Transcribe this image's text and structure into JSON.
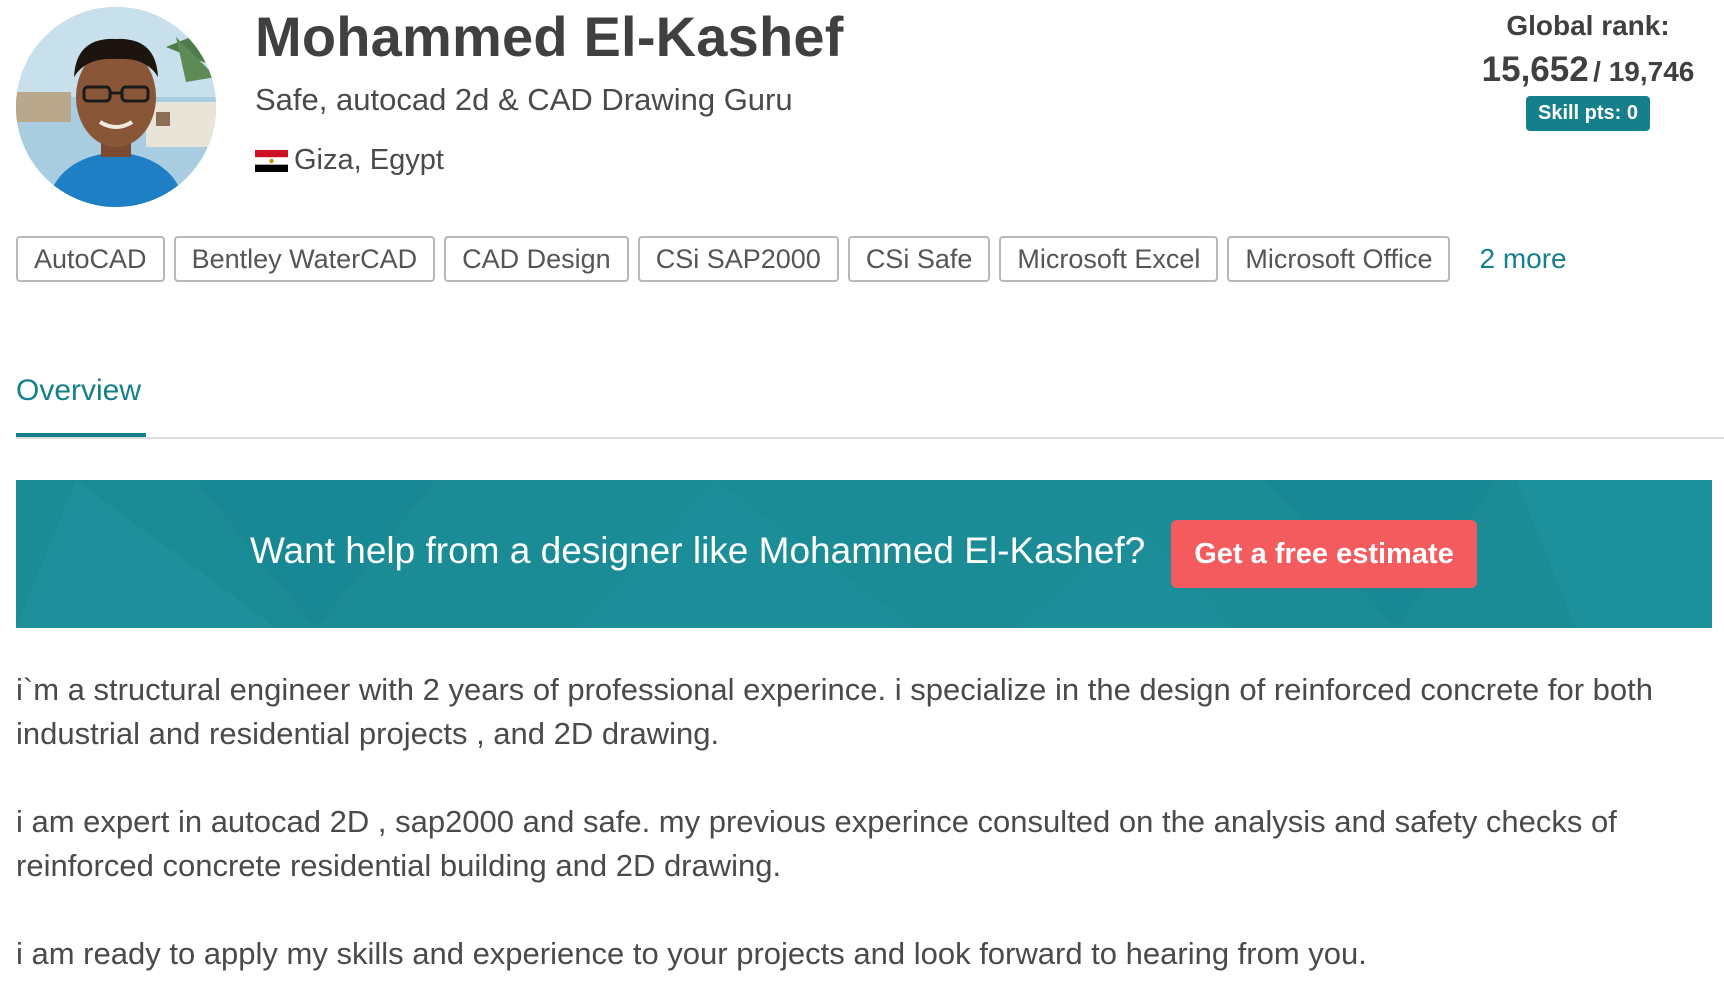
{
  "profile": {
    "name": "Mohammed El-Kashef",
    "tagline": "Safe, autocad 2d & CAD Drawing Guru",
    "location": "Giza, Egypt"
  },
  "rank": {
    "label": "Global rank:",
    "value": "15,652",
    "total": "/ 19,746",
    "skill_pts": "Skill pts: 0"
  },
  "skills": {
    "tags": [
      "AutoCAD",
      "Bentley WaterCAD",
      "CAD Design",
      "CSi SAP2000",
      "CSi Safe",
      "Microsoft Excel",
      "Microsoft Office"
    ],
    "more_label": "2 more"
  },
  "tabs": {
    "overview_label": "Overview"
  },
  "banner": {
    "text": "Want help from a designer like Mohammed El-Kashef?",
    "button_label": "Get a free estimate"
  },
  "bio": {
    "paragraphs": [
      "i`m a structural engineer with 2 years of professional experince. i specialize in the design of reinforced concrete for both industrial and residential projects , and 2D drawing.",
      "i am expert in autocad 2D , sap2000 and safe. my previous experince consulted on the analysis and safety checks of reinforced concrete residential building and 2D drawing.",
      "i am ready to apply my skills and experience to your projects and look forward to hearing from you."
    ]
  },
  "colors": {
    "accent": "#15808b",
    "banner": "#1b8b96",
    "button": "#f45b5f"
  }
}
